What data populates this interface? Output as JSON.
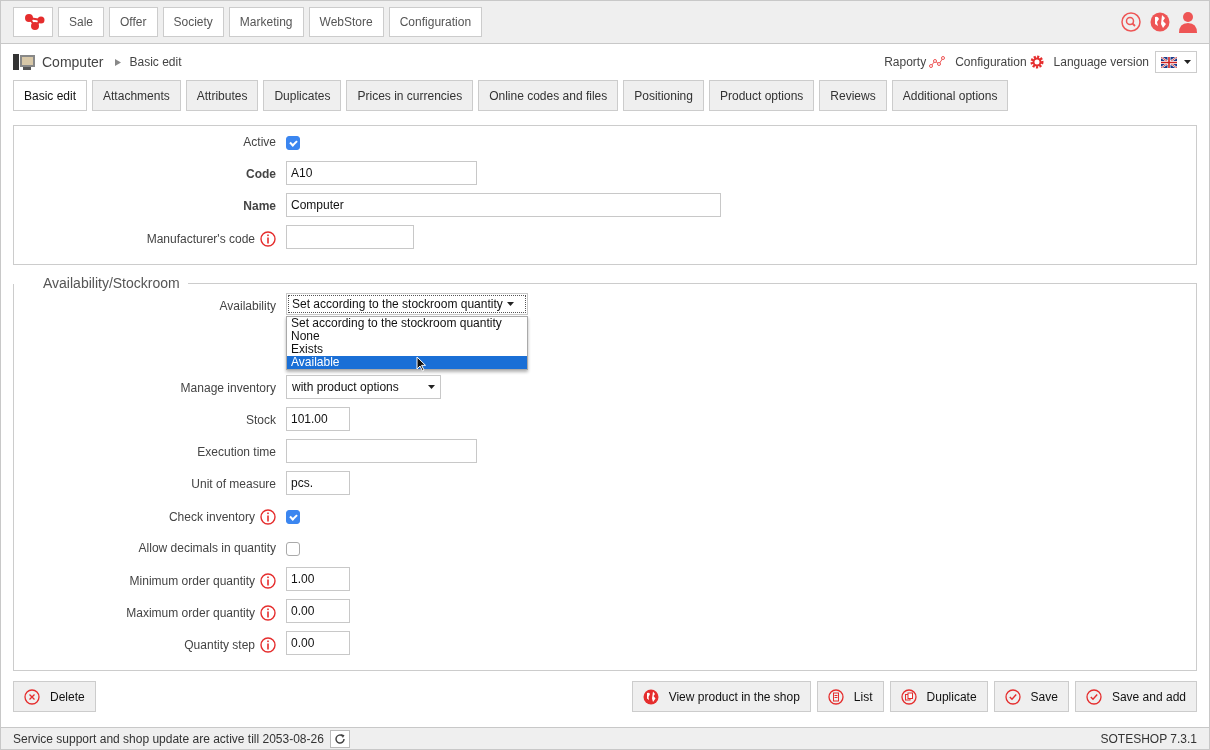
{
  "top_menu": [
    {
      "label": "Sale"
    },
    {
      "label": "Offer"
    },
    {
      "label": "Society"
    },
    {
      "label": "Marketing"
    },
    {
      "label": "WebStore"
    },
    {
      "label": "Configuration"
    }
  ],
  "breadcrumb": {
    "title": "Computer",
    "current": "Basic edit"
  },
  "header_links": [
    {
      "label": "Raporty",
      "kind": "chart"
    },
    {
      "label": "Configuration",
      "kind": "gear"
    }
  ],
  "language": {
    "label": "Language version"
  },
  "tabs": [
    {
      "label": "Basic edit",
      "selected": true
    },
    {
      "label": "Attachments",
      "selected": false
    },
    {
      "label": "Attributes",
      "selected": false
    },
    {
      "label": "Duplicates",
      "selected": false
    },
    {
      "label": "Prices in currencies",
      "selected": false
    },
    {
      "label": "Online codes and files",
      "selected": false
    },
    {
      "label": "Positioning",
      "selected": false
    },
    {
      "label": "Product options",
      "selected": false
    },
    {
      "label": "Reviews",
      "selected": false
    },
    {
      "label": "Additional options",
      "selected": false
    }
  ],
  "basic_fields": [
    {
      "kind": "checkbox",
      "label": "Active",
      "checked": true,
      "info": false,
      "bold": false
    },
    {
      "kind": "text",
      "label": "Code",
      "value": "A10",
      "info": false,
      "bold": true
    },
    {
      "kind": "text",
      "label": "Name",
      "value": "Computer",
      "info": false,
      "bold": true
    },
    {
      "kind": "text",
      "label": "Manufacturer's code",
      "info": true,
      "bold": false
    }
  ],
  "stockroom": {
    "legend": "Availability/Stockroom",
    "fields": [
      {
        "kind": "dropdown",
        "label": "Availability",
        "value": "Set according to the stockroom quantity",
        "info": false,
        "bold": false,
        "options": [
          {
            "label": "Set according to the stockroom quantity",
            "highlighted": false
          },
          {
            "label": "None",
            "highlighted": false
          },
          {
            "label": "Exists",
            "highlighted": false
          },
          {
            "label": "Available",
            "highlighted": true
          }
        ]
      },
      {
        "kind": "select",
        "label": "Manage inventory",
        "value": "with product options",
        "info": false,
        "bold": false
      },
      {
        "kind": "text",
        "label": "Stock",
        "value": "101.00",
        "info": false,
        "bold": false
      },
      {
        "kind": "text",
        "label": "Execution time",
        "info": false,
        "bold": false
      },
      {
        "kind": "text",
        "label": "Unit of measure",
        "value": "pcs.",
        "info": false,
        "bold": false
      },
      {
        "kind": "checkbox",
        "label": "Check inventory",
        "checked": true,
        "info": true,
        "bold": false
      },
      {
        "kind": "checkbox",
        "label": "Allow decimals in quantity",
        "checked": false,
        "info": false,
        "bold": false
      },
      {
        "kind": "text",
        "label": "Minimum order quantity",
        "value": "1.00",
        "info": true,
        "bold": false
      },
      {
        "kind": "text",
        "label": "Maximum order quantity",
        "value": "0.00",
        "info": true,
        "bold": false
      },
      {
        "kind": "text",
        "label": "Quantity step",
        "value": "0.00",
        "info": true,
        "bold": false
      }
    ]
  },
  "left_buttons": [
    {
      "label": "Delete",
      "kind": "delete"
    }
  ],
  "right_buttons": [
    {
      "label": "View product in the shop",
      "kind": "globe"
    },
    {
      "label": "List",
      "kind": "list"
    },
    {
      "label": "Duplicate",
      "kind": "duplicate"
    },
    {
      "label": "Save",
      "kind": "check"
    },
    {
      "label": "Save and add",
      "kind": "check"
    }
  ],
  "status_bar": {
    "message": "Service support and shop update are active till 2053-08-26",
    "version": "SOTESHOP 7.3.1"
  }
}
